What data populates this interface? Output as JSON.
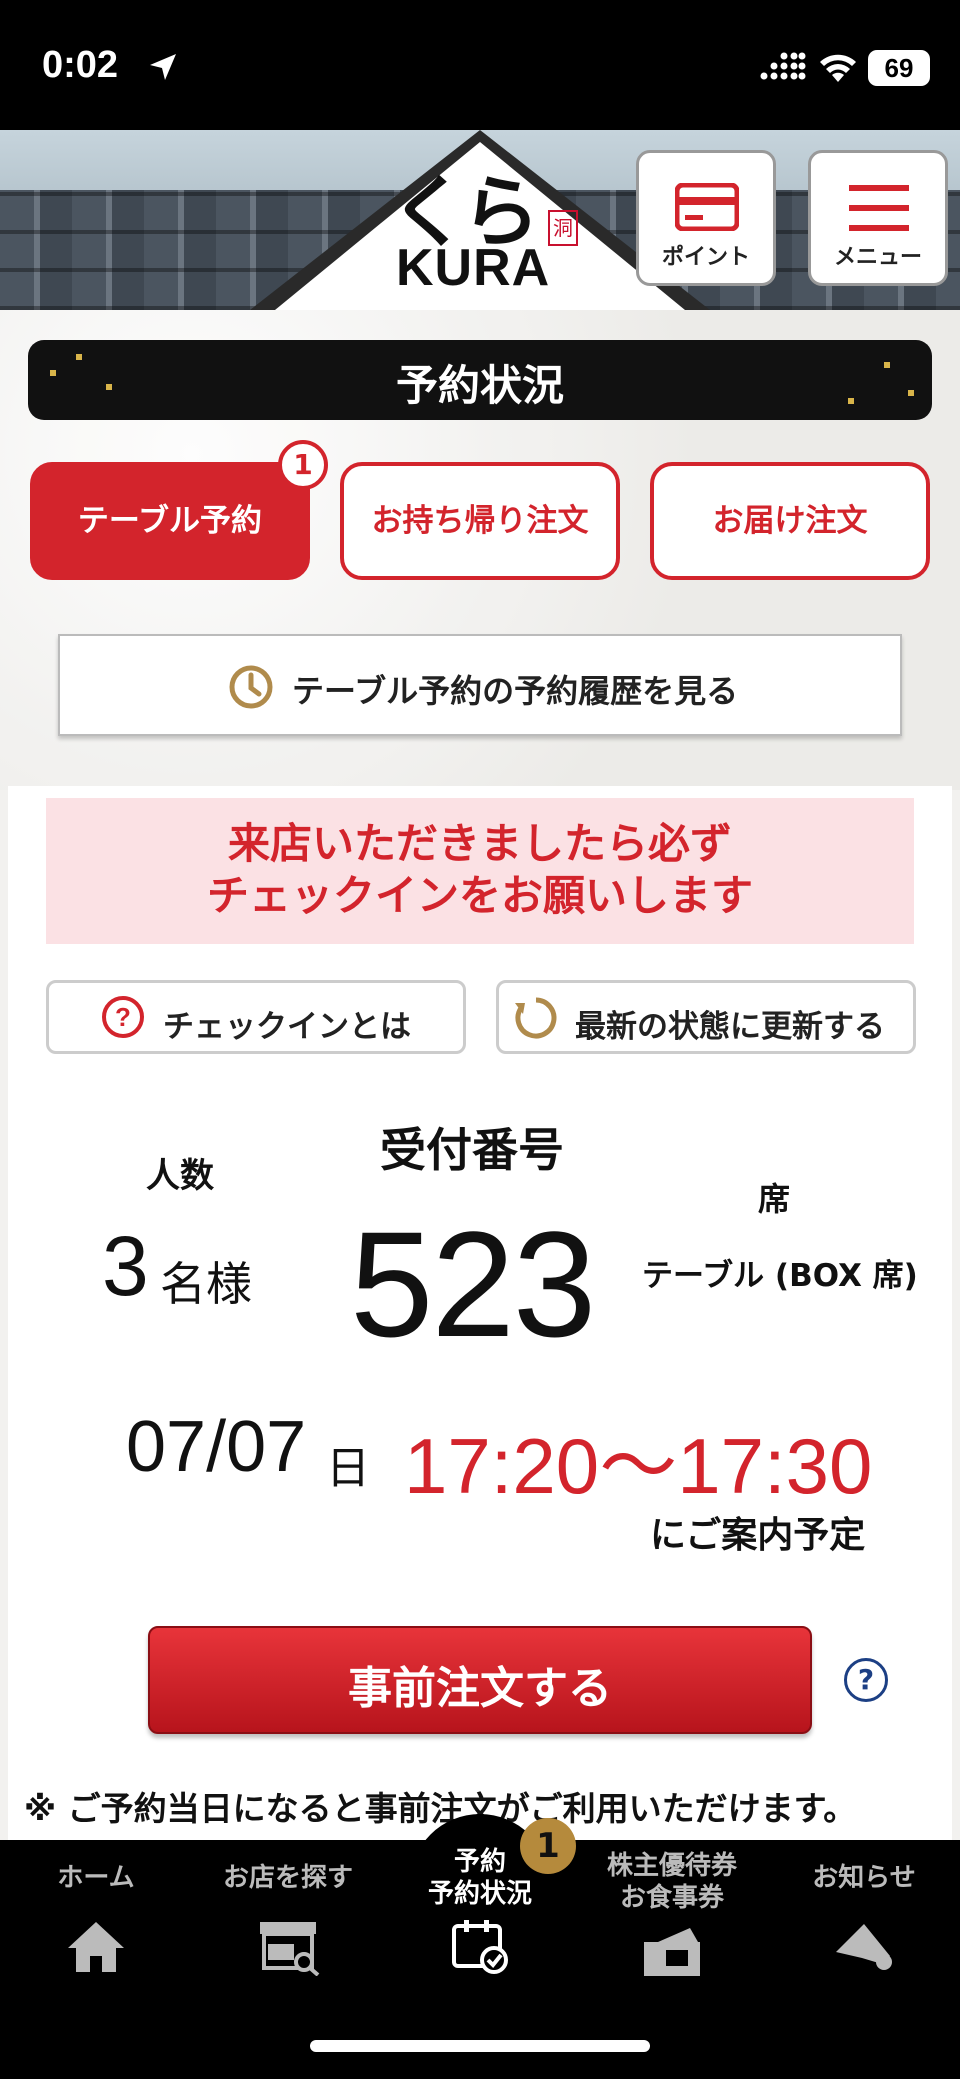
{
  "status_bar": {
    "time": "0:02",
    "battery": "69"
  },
  "header": {
    "logo_jp": "くら",
    "logo_seal": "洞",
    "logo_en": "KURA",
    "point_label": "ポイント",
    "menu_label": "メニュー"
  },
  "page_title": "予約状況",
  "tabs": [
    {
      "label": "テーブル予約",
      "active": true,
      "badge": "1"
    },
    {
      "label": "お持ち帰り注文",
      "active": false
    },
    {
      "label": "お届け注文",
      "active": false
    }
  ],
  "history_button": "テーブル予約の予約履歴を見る",
  "notice": {
    "line1": "来店いただきましたら必ず",
    "line2": "チェックインをお願いします"
  },
  "checkin_button": "チェックインとは",
  "refresh_button": "最新の状態に更新する",
  "reservation": {
    "people_label": "人数",
    "people_value": "3",
    "people_unit": "名様",
    "receipt_label": "受付番号",
    "receipt_number": "523",
    "seat_label": "席",
    "seat_value": "テーブル (BOX 席)",
    "date": "07/07",
    "date_unit": "日",
    "time_range": "17:20〜17:30",
    "guide_text": "にご案内予定"
  },
  "preorder_button": "事前注文する",
  "help_icon_text": "?",
  "footnote": "※ ご予約当日になると事前注文がご利用いただけます。",
  "bottom_nav": {
    "items": [
      {
        "label": "ホーム",
        "icon": "home-icon"
      },
      {
        "label": "お店を探す",
        "icon": "store-search-icon"
      },
      {
        "label": "予約\n予約状況",
        "icon": "calendar-check-icon",
        "active": true
      },
      {
        "label": "株主優待券\nお食事券",
        "icon": "ticket-icon"
      },
      {
        "label": "お知らせ",
        "icon": "megaphone-icon"
      }
    ],
    "badge": "1"
  },
  "colors": {
    "accent_red": "#d3242c",
    "gold": "#b58a3c",
    "help_blue": "#1c3f84"
  }
}
